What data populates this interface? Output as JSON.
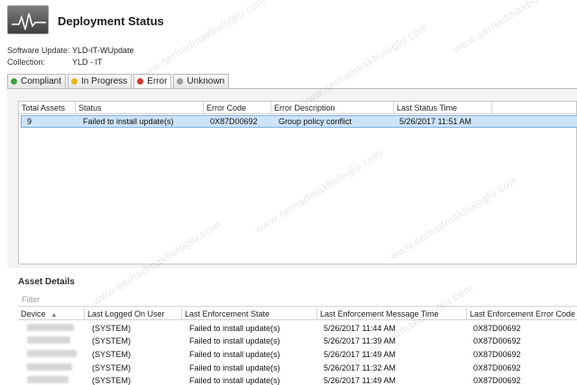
{
  "header": {
    "title": "Deployment Status",
    "software_update_label": "Software Update:",
    "software_update_value": "YLD-IT-WUpdate",
    "collection_label": "Collection:",
    "collection_value": "YLD - IT"
  },
  "tabs": [
    {
      "label": "Compliant",
      "color": "#3aa53a",
      "active": false
    },
    {
      "label": "In Progress",
      "color": "#e5b81a",
      "active": false
    },
    {
      "label": "Error",
      "color": "#d23a2a",
      "active": true
    },
    {
      "label": "Unknown",
      "color": "#9b9b9b",
      "active": false
    }
  ],
  "status_grid": {
    "columns": [
      "Total Assets",
      "Status",
      "Error Code",
      "Error Description",
      "Last Status Time"
    ],
    "rows": [
      {
        "total_assets": "9",
        "status": "Failed to install update(s)",
        "error_code": "0X87D00692",
        "error_description": "Group policy conflict",
        "last_status_time": "5/26/2017 11:51 AM"
      }
    ]
  },
  "asset_details": {
    "title": "Asset Details",
    "filter_placeholder": "Filter",
    "columns": [
      "Device",
      "Last Logged On User",
      "Last Enforcement State",
      "Last Enforcement Message Time",
      "Last Enforcement Error Code"
    ],
    "rows": [
      {
        "device": "",
        "user": "(SYSTEM)",
        "state": "Failed to install update(s)",
        "time": "5/26/2017 11:44 AM",
        "code": "0X87D00692"
      },
      {
        "device": "",
        "user": "(SYSTEM)",
        "state": "Failed to install update(s)",
        "time": "5/26/2017 11:39 AM",
        "code": "0X87D00692"
      },
      {
        "device": "",
        "user": "(SYSTEM)",
        "state": "Failed to install update(s)",
        "time": "5/26/2017 11:49 AM",
        "code": "0X87D00692"
      },
      {
        "device": "",
        "user": "(SYSTEM)",
        "state": "Failed to install update(s)",
        "time": "5/26/2017 11:32 AM",
        "code": "0X87D00692"
      },
      {
        "device": "",
        "user": "(SYSTEM)",
        "state": "Failed to install update(s)",
        "time": "5/26/2017 11:49 AM",
        "code": "0X87D00692"
      }
    ]
  },
  "watermark": "www.serhadmakbuloglu.com"
}
